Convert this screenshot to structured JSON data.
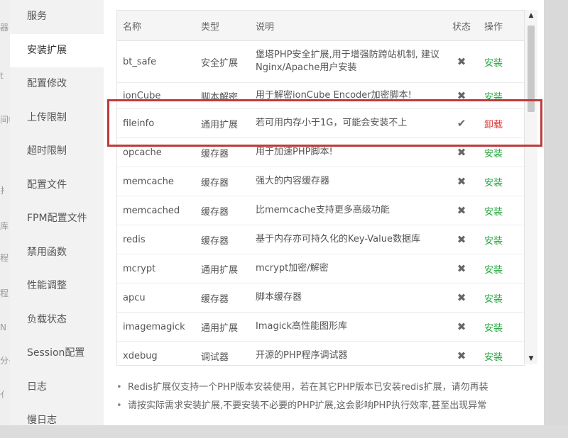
{
  "background_fragments": [
    "器",
    "t",
    "间帐",
    "扌",
    "库",
    "程",
    "程",
    "N",
    "分子",
    "亻"
  ],
  "sidebar": {
    "items": [
      {
        "label": "服务",
        "active": false
      },
      {
        "label": "安装扩展",
        "active": true
      },
      {
        "label": "配置修改",
        "active": false
      },
      {
        "label": "上传限制",
        "active": false
      },
      {
        "label": "超时限制",
        "active": false
      },
      {
        "label": "配置文件",
        "active": false
      },
      {
        "label": "FPM配置文件",
        "active": false
      },
      {
        "label": "禁用函数",
        "active": false
      },
      {
        "label": "性能调整",
        "active": false
      },
      {
        "label": "负载状态",
        "active": false
      },
      {
        "label": "Session配置",
        "active": false
      },
      {
        "label": "日志",
        "active": false
      },
      {
        "label": "慢日志",
        "active": false
      }
    ]
  },
  "table": {
    "headers": {
      "name": "名称",
      "type": "类型",
      "desc": "说明",
      "status": "状态",
      "action": "操作"
    },
    "rows": [
      {
        "name": "bt_safe",
        "type": "安全扩展",
        "desc": "堡塔PHP安全扩展,用于增强防跨站机制, 建议Nginx/Apache用户安装",
        "status": "✖",
        "action": "安装"
      },
      {
        "name": "ionCube",
        "type": "脚本解密",
        "desc": "用于解密ionCube Encoder加密脚本!",
        "status": "✖",
        "action": "安装"
      },
      {
        "name": "fileinfo",
        "type": "通用扩展",
        "desc": "若可用内存小于1G，可能会安装不上",
        "status": "✔",
        "action": "卸载"
      },
      {
        "name": "opcache",
        "type": "缓存器",
        "desc": "用于加速PHP脚本!",
        "status": "✖",
        "action": "安装"
      },
      {
        "name": "memcache",
        "type": "缓存器",
        "desc": "强大的内容缓存器",
        "status": "✖",
        "action": "安装"
      },
      {
        "name": "memcached",
        "type": "缓存器",
        "desc": "比memcache支持更多高级功能",
        "status": "✖",
        "action": "安装"
      },
      {
        "name": "redis",
        "type": "缓存器",
        "desc": "基于内存亦可持久化的Key-Value数据库",
        "status": "✖",
        "action": "安装"
      },
      {
        "name": "mcrypt",
        "type": "通用扩展",
        "desc": "mcrypt加密/解密",
        "status": "✖",
        "action": "安装"
      },
      {
        "name": "apcu",
        "type": "缓存器",
        "desc": "脚本缓存器",
        "status": "✖",
        "action": "安装"
      },
      {
        "name": "imagemagick",
        "type": "通用扩展",
        "desc": "Imagick高性能图形库",
        "status": "✖",
        "action": "安装"
      },
      {
        "name": "xdebug",
        "type": "调试器",
        "desc": "开源的PHP程序调试器",
        "status": "✖",
        "action": "安装"
      }
    ]
  },
  "scrollbar": {
    "up_arrow": "▲",
    "down_arrow": "▼"
  },
  "notes": [
    "Redis扩展仅支持一个PHP版本安装使用，若在其它PHP版本已安装redis扩展，请勿再装",
    "请按实际需求安装扩展,不要安装不必要的PHP扩展,这会影响PHP执行效率,甚至出现异常"
  ],
  "colors": {
    "install": "#20a53a",
    "uninstall": "#e0332f",
    "highlight_box": "#c0393b"
  }
}
